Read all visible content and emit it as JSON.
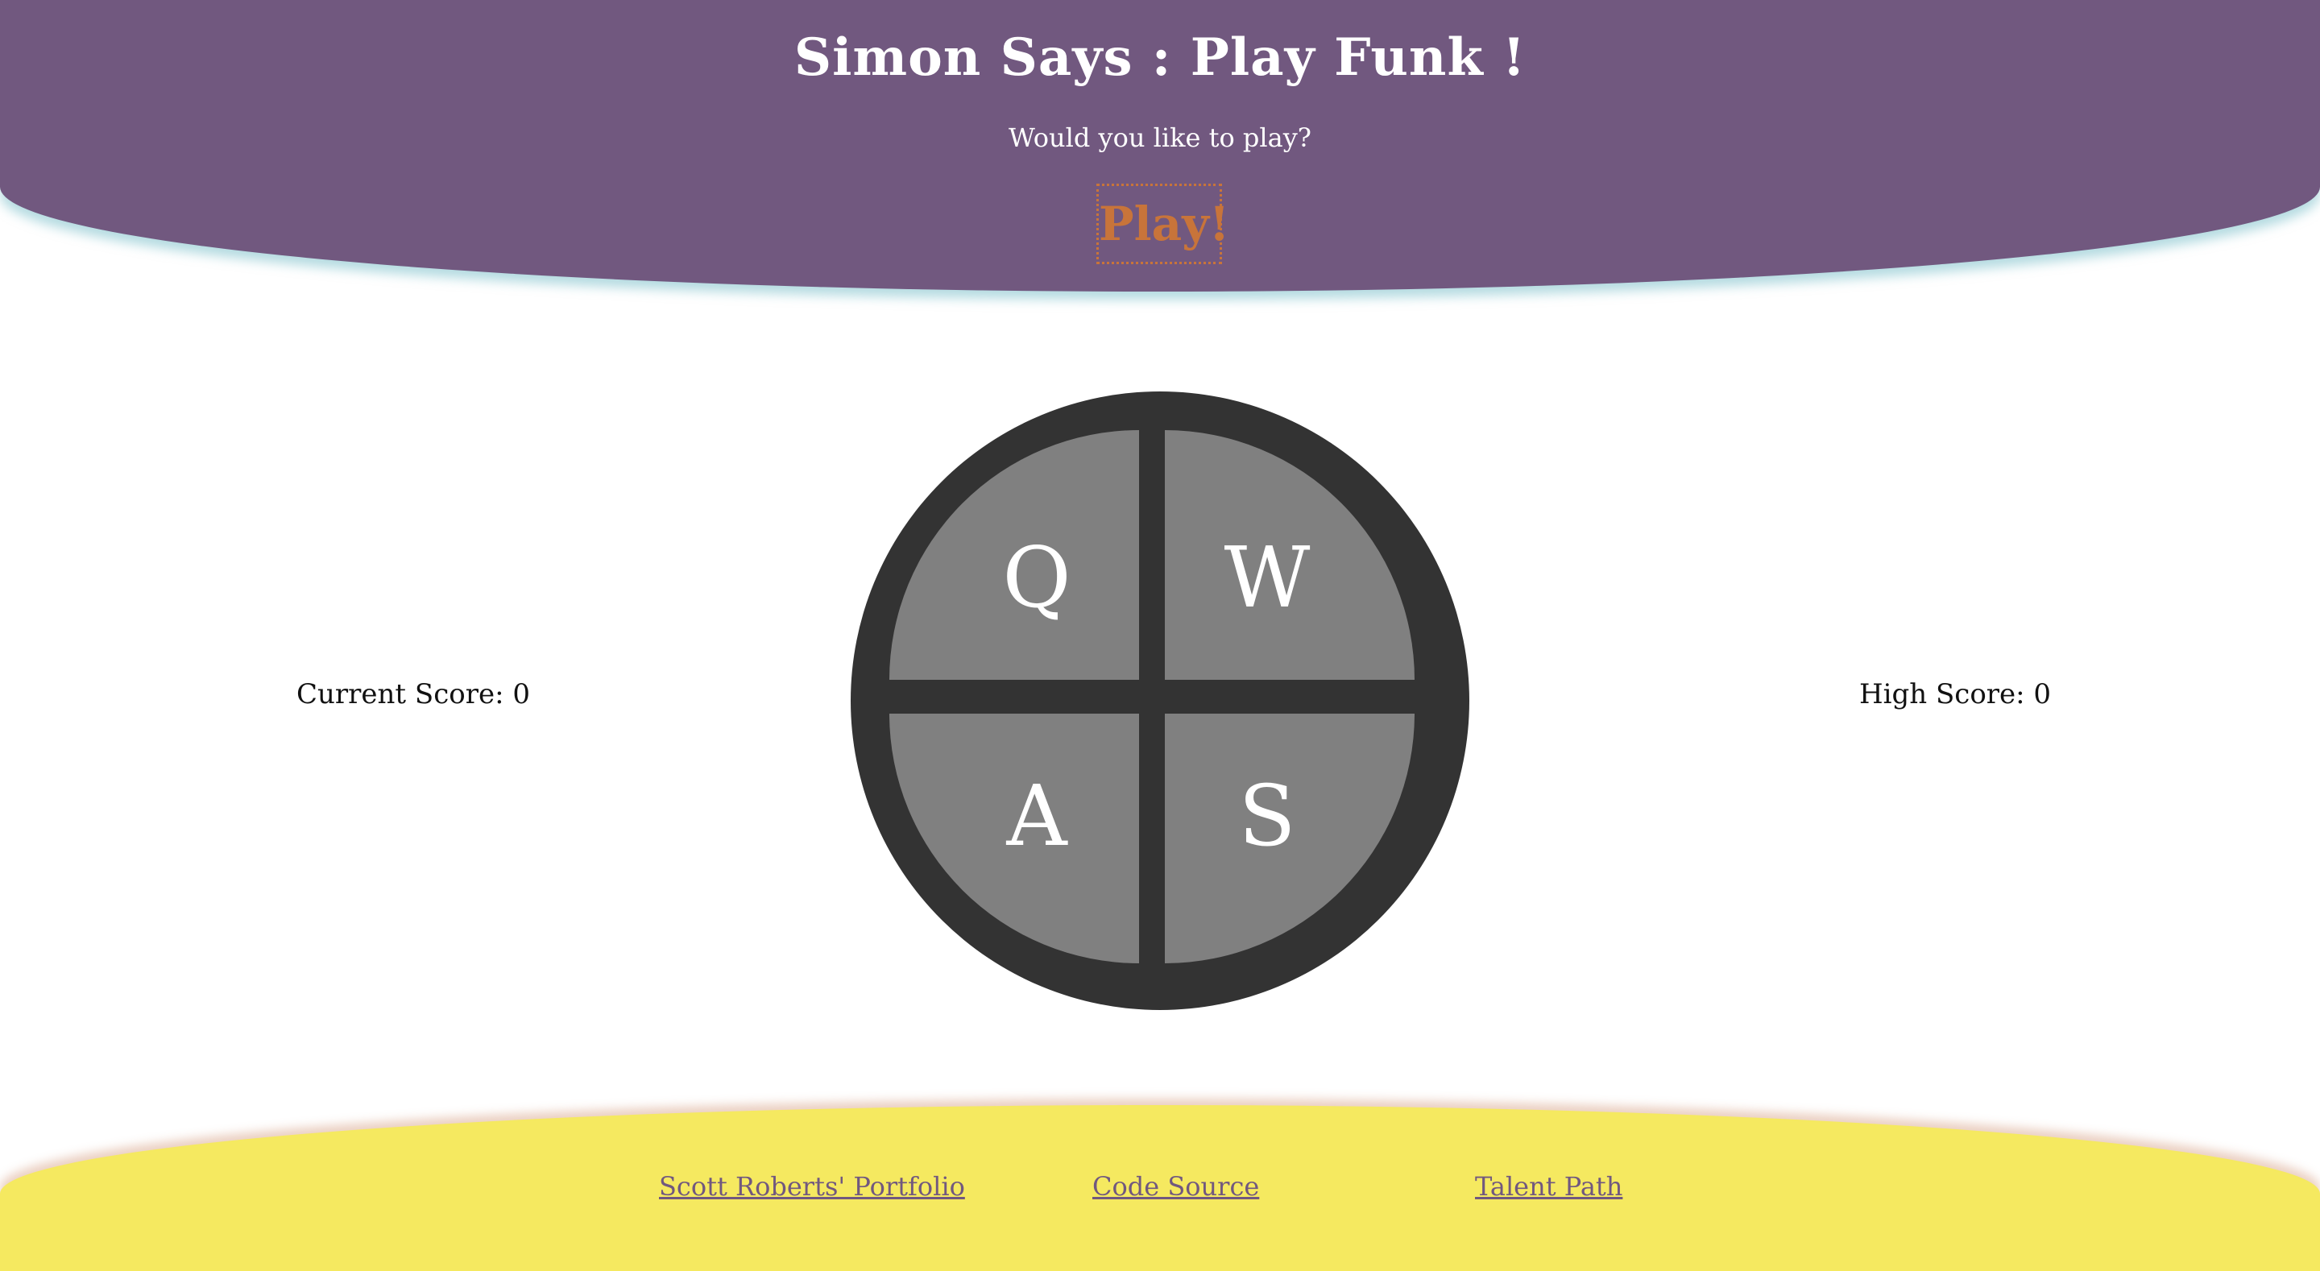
{
  "header": {
    "title": "Simon Says : Play Funk !",
    "prompt": "Would you like to play?",
    "play_label": "Play!"
  },
  "scores": {
    "current_label": "Current Score: 0",
    "high_label": "High Score: 0"
  },
  "board": {
    "pads": [
      {
        "key": "Q"
      },
      {
        "key": "W"
      },
      {
        "key": "A"
      },
      {
        "key": "S"
      }
    ]
  },
  "footer": {
    "links": [
      {
        "label": "Scott Roberts' Portfolio"
      },
      {
        "label": "Code Source"
      },
      {
        "label": "Talent Path"
      }
    ]
  },
  "colors": {
    "header_bg": "#71587f",
    "footer_bg": "#f5e960",
    "play_accent": "#c8743a",
    "board_ring": "#333333",
    "pad_fill": "#808080"
  }
}
